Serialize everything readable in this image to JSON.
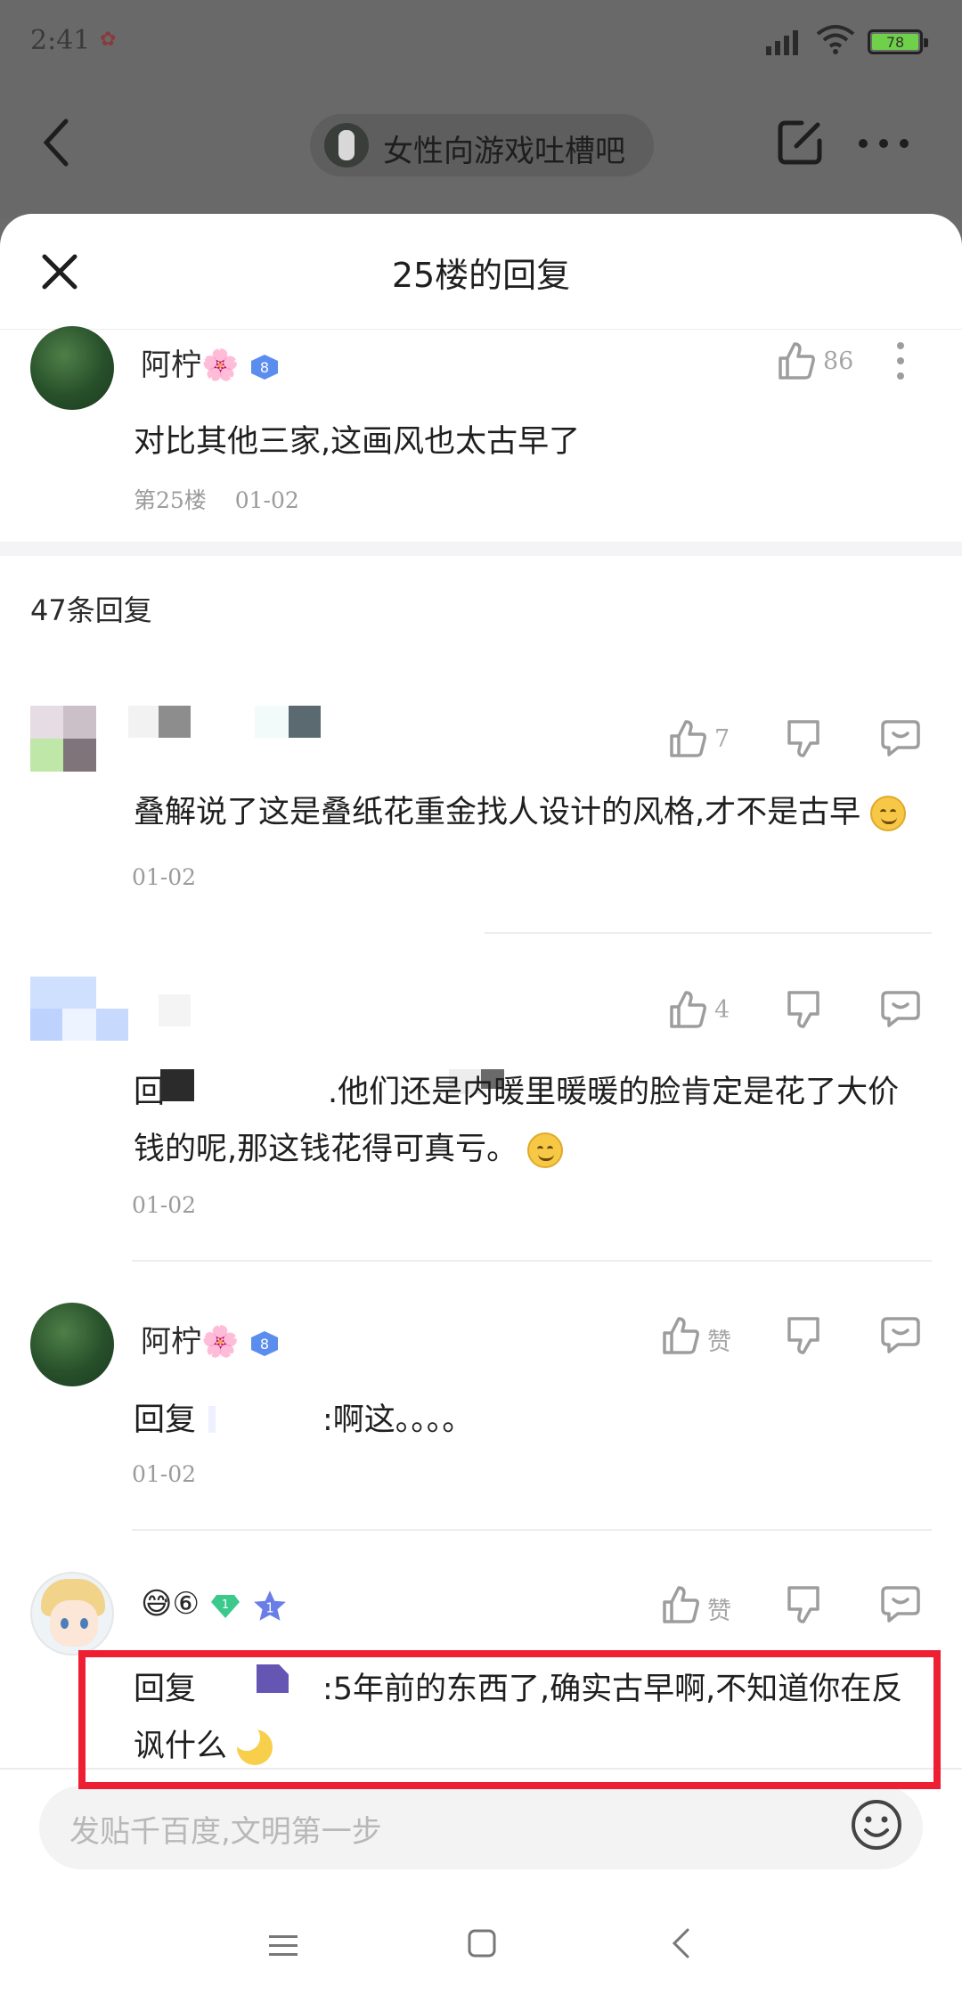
{
  "status_bar": {
    "time": "2:41",
    "battery": "78"
  },
  "topbar": {
    "forum_name": "女性向游戏吐槽吧"
  },
  "sheet": {
    "title": "25楼的回复"
  },
  "main_post": {
    "username": "阿柠🌸",
    "level": "8",
    "likes": "86",
    "content": "对比其他三家,这画风也太古早了",
    "floor": "第25楼",
    "date": "01-02"
  },
  "replies_header": "47条回复",
  "replies": [
    {
      "username": "",
      "likes": "7",
      "content": "叠解说了这是叠纸花重金找人设计的风格,才不是古早",
      "date": "01-02"
    },
    {
      "username": "",
      "likes": "4",
      "content_line1_prefix": "回",
      "content_line1": ".他们还是内暖里暖暖的脸肯定是花了大价",
      "content_line2": "钱的呢,那这钱花得可真亏。",
      "date": "01-02"
    },
    {
      "username": "阿柠🌸",
      "level": "8",
      "likes": "赞",
      "content_prefix": "回复",
      "content": ":啊这。。。。",
      "date": "01-02"
    },
    {
      "username": "😅⑥",
      "level_badge": "1",
      "rank_badge": "1",
      "likes": "赞",
      "content_prefix": "回复",
      "content_line1": ":5年前的东西了,确实古早啊,不知道你在反",
      "content_line2": "讽什么"
    }
  ],
  "input": {
    "placeholder": "发贴千百度,文明第一步"
  },
  "colors": {
    "accent_red": "#ee1f33",
    "badge_blue": "#5b8def"
  }
}
